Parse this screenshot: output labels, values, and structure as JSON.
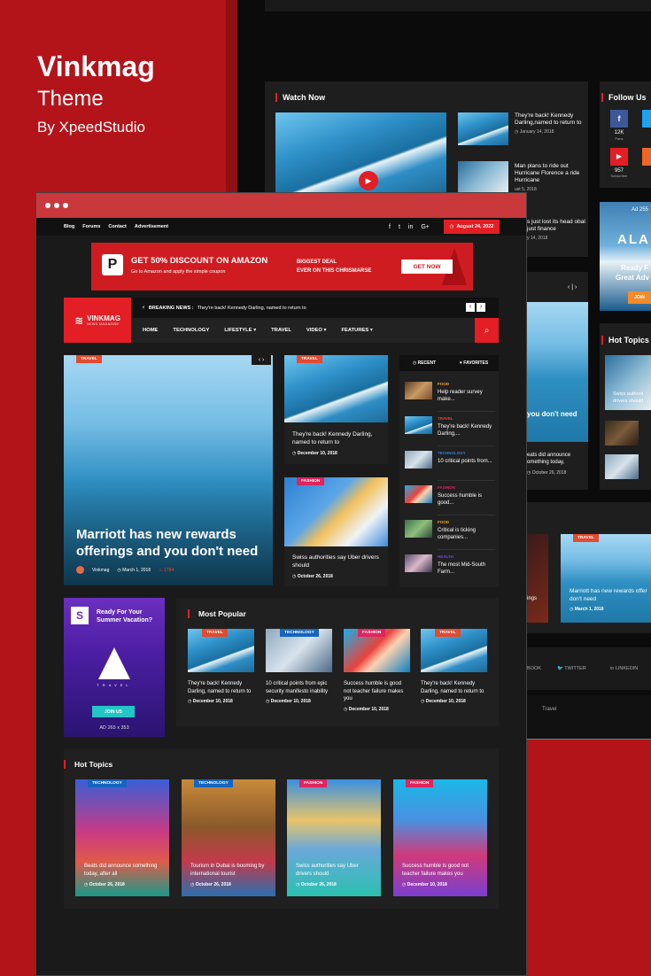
{
  "brand": {
    "title": "Vinkmag",
    "subtitle": "Theme",
    "by": "By XpeedStudio"
  },
  "background_screen": {
    "watch_now": "Watch Now",
    "follow_us": "Follow Us",
    "hot_topics": "Hot Topics",
    "watch_items": [
      {
        "title": "They're back! Kennedy Darling,named to return to",
        "date": "January 14, 2018"
      },
      {
        "title": "Man plans to ride out Hurricane Florence a ride Hurricane",
        "date": "ust 5, 2018"
      },
      {
        "title": "s just lost its head obal just finance",
        "date": "y 14, 2018"
      }
    ],
    "social": [
      {
        "count": "12K",
        "label": "Fans"
      },
      {
        "count": "957",
        "label": "Subscriber"
      }
    ],
    "ad_text": "Ad 255",
    "ala": "ALA",
    "ready": "Ready F",
    "great": "Great Adv",
    "join": "JOIN",
    "you_dont_need": "you don't need",
    "hot_side_1": "Swiss authorit drivers should",
    "mid_text": "eats did announce omething today,",
    "mid_date": "October 26, 2018",
    "lower_card": {
      "category": "TRAVEL",
      "title": "Marriott has new rewards offer don't need",
      "date": "March 1, 2018"
    },
    "lower_left": "ings",
    "social_footer": [
      "BOOK",
      "TWITTER",
      "LINKEDIN"
    ],
    "footer_travel": "Travel"
  },
  "topbar": {
    "links": [
      "Blog",
      "Forums",
      "Contact",
      "Advertisement"
    ],
    "social_icons": [
      "f",
      "t",
      "in",
      "G+"
    ],
    "date": "August 24, 2022"
  },
  "ad": {
    "headline": "GET 50% DISCOUNT ON AMAZON",
    "sub": "Go to Amazon and apply the simple coupon",
    "deal_1": "BIGGEST DEAL",
    "deal_2": "EVER ON THIS CHRISMARSE",
    "button": "GET NOW"
  },
  "header": {
    "logo": "VINKMAG",
    "logo_tag": "NEWS MAGAZINE",
    "breaking_label": "BREAKING NEWS :",
    "breaking_text": "They're back! Kennedy Darling, named to return to",
    "nav": [
      "HOME",
      "TECHNOLOGY",
      "LIFESTYLE",
      "TRAVEL",
      "VIDEO",
      "FEATURES"
    ]
  },
  "hero": {
    "category": "TRAVEL",
    "title": "Marriott has new rewards offerings and you don't need",
    "author": "Vinkmag",
    "date": "March 1, 2018",
    "views": "1784"
  },
  "mid_cards": [
    {
      "category": "TRAVEL",
      "title": "They're back! Kennedy Darling, named to return to",
      "date": "December 10, 2018"
    },
    {
      "category": "FASHION",
      "title": "Swiss authorities say Uber drivers should",
      "date": "October 26, 2018"
    }
  ],
  "sidebar": {
    "tabs": [
      "RECENT",
      "FAVORITES"
    ],
    "items": [
      {
        "category": "FOOD",
        "title": "Help reader survey make..."
      },
      {
        "category": "TRAVEL",
        "title": "They're back! Kennedy Darling,..."
      },
      {
        "category": "TECHNOLOGY",
        "title": "10 critical points from..."
      },
      {
        "category": "FASHION",
        "title": "Success humble is good..."
      },
      {
        "category": "FOOD",
        "title": "Critical is ticking companies..."
      },
      {
        "category": "HEALTH",
        "title": "The most Mid-South Farm..."
      }
    ]
  },
  "vacation_ad": {
    "logo": "S",
    "title": "Ready For Your Summer Vacation?",
    "brand": "TRAVEL",
    "button": "JOIN US",
    "size": "AD 265 x 353"
  },
  "most_popular": {
    "title": "Most Popular",
    "items": [
      {
        "category": "TRAVEL",
        "title": "They're back! Kennedy Darling, named to return to",
        "date": "December 10, 2018"
      },
      {
        "category": "TECHNOLOGY",
        "title": "10 critical points from epic security manifesto inability",
        "date": "December 10, 2018"
      },
      {
        "category": "FASHION",
        "title": "Success humble is good not teacher failure makes you",
        "date": "December 10, 2018"
      },
      {
        "category": "TRAVEL",
        "title": "They're back! Kennedy Darling, named to return to",
        "date": "December 10, 2018"
      }
    ]
  },
  "hot_topics": {
    "title": "Hot Topics",
    "items": [
      {
        "category": "TECHNOLOGY",
        "title": "Beats did announce something today, after all",
        "date": "October 26, 2018"
      },
      {
        "category": "TECHNOLOGY",
        "title": "Tourism in Dubai is booming by international tourist",
        "date": "October 26, 2018"
      },
      {
        "category": "FASHION",
        "title": "Swiss authorities say Uber drivers should",
        "date": "October 26, 2018"
      },
      {
        "category": "FASHION",
        "title": "Success humble is good not teacher failure makes you",
        "date": "December 10, 2018"
      }
    ]
  },
  "colors": {
    "accent": "#e31e24",
    "brand_red": "#b3141a",
    "window_bar": "#c9383b"
  }
}
